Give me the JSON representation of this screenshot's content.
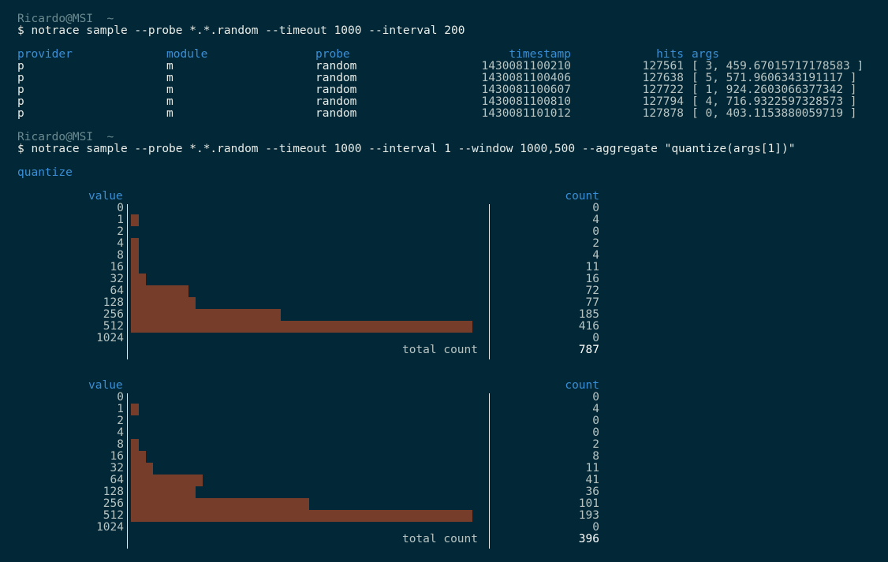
{
  "prompt1": {
    "user_host": "Ricardo@MSI",
    "cwd": "~"
  },
  "command1": "$ notrace sample --probe *.*.random --timeout 1000 --interval 200",
  "table": {
    "columns": [
      "provider",
      "module",
      "probe",
      "timestamp",
      "hits",
      "args"
    ],
    "rows": [
      {
        "provider": "p",
        "module": "m",
        "probe": "random",
        "timestamp": "1430081100210",
        "hits": "127561",
        "args": "[ 3, 459.67015717178583 ]"
      },
      {
        "provider": "p",
        "module": "m",
        "probe": "random",
        "timestamp": "1430081100406",
        "hits": "127638",
        "args": "[ 5, 571.9606343191117 ]"
      },
      {
        "provider": "p",
        "module": "m",
        "probe": "random",
        "timestamp": "1430081100607",
        "hits": "127722",
        "args": "[ 1, 924.2603066377342 ]"
      },
      {
        "provider": "p",
        "module": "m",
        "probe": "random",
        "timestamp": "1430081100810",
        "hits": "127794",
        "args": "[ 4, 716.9322597328573 ]"
      },
      {
        "provider": "p",
        "module": "m",
        "probe": "random",
        "timestamp": "1430081101012",
        "hits": "127878",
        "args": "[ 0, 403.1153880059719 ]"
      }
    ]
  },
  "prompt2": {
    "user_host": "Ricardo@MSI",
    "cwd": "~"
  },
  "command2": "$ notrace sample --probe *.*.random --timeout 1000 --interval 1 --window 1000,500 --aggregate \"quantize(args[1])\"",
  "aggregate_label": "quantize",
  "chart_data": [
    {
      "type": "bar",
      "orientation": "horizontal",
      "xlabel": "value",
      "ylabel": "count",
      "categories": [
        "0",
        "1",
        "2",
        "4",
        "8",
        "16",
        "32",
        "64",
        "128",
        "256",
        "512",
        "1024"
      ],
      "values": [
        0,
        4,
        0,
        2,
        4,
        11,
        16,
        72,
        77,
        185,
        416,
        0
      ],
      "total_label": "total count",
      "total": 787,
      "bar_color": "#763d2b"
    },
    {
      "type": "bar",
      "orientation": "horizontal",
      "xlabel": "value",
      "ylabel": "count",
      "categories": [
        "0",
        "1",
        "2",
        "4",
        "8",
        "16",
        "32",
        "64",
        "128",
        "256",
        "512",
        "1024"
      ],
      "values": [
        0,
        4,
        0,
        0,
        2,
        8,
        11,
        41,
        36,
        101,
        193,
        0
      ],
      "total_label": "total count",
      "total": 396,
      "bar_color": "#763d2b"
    }
  ]
}
